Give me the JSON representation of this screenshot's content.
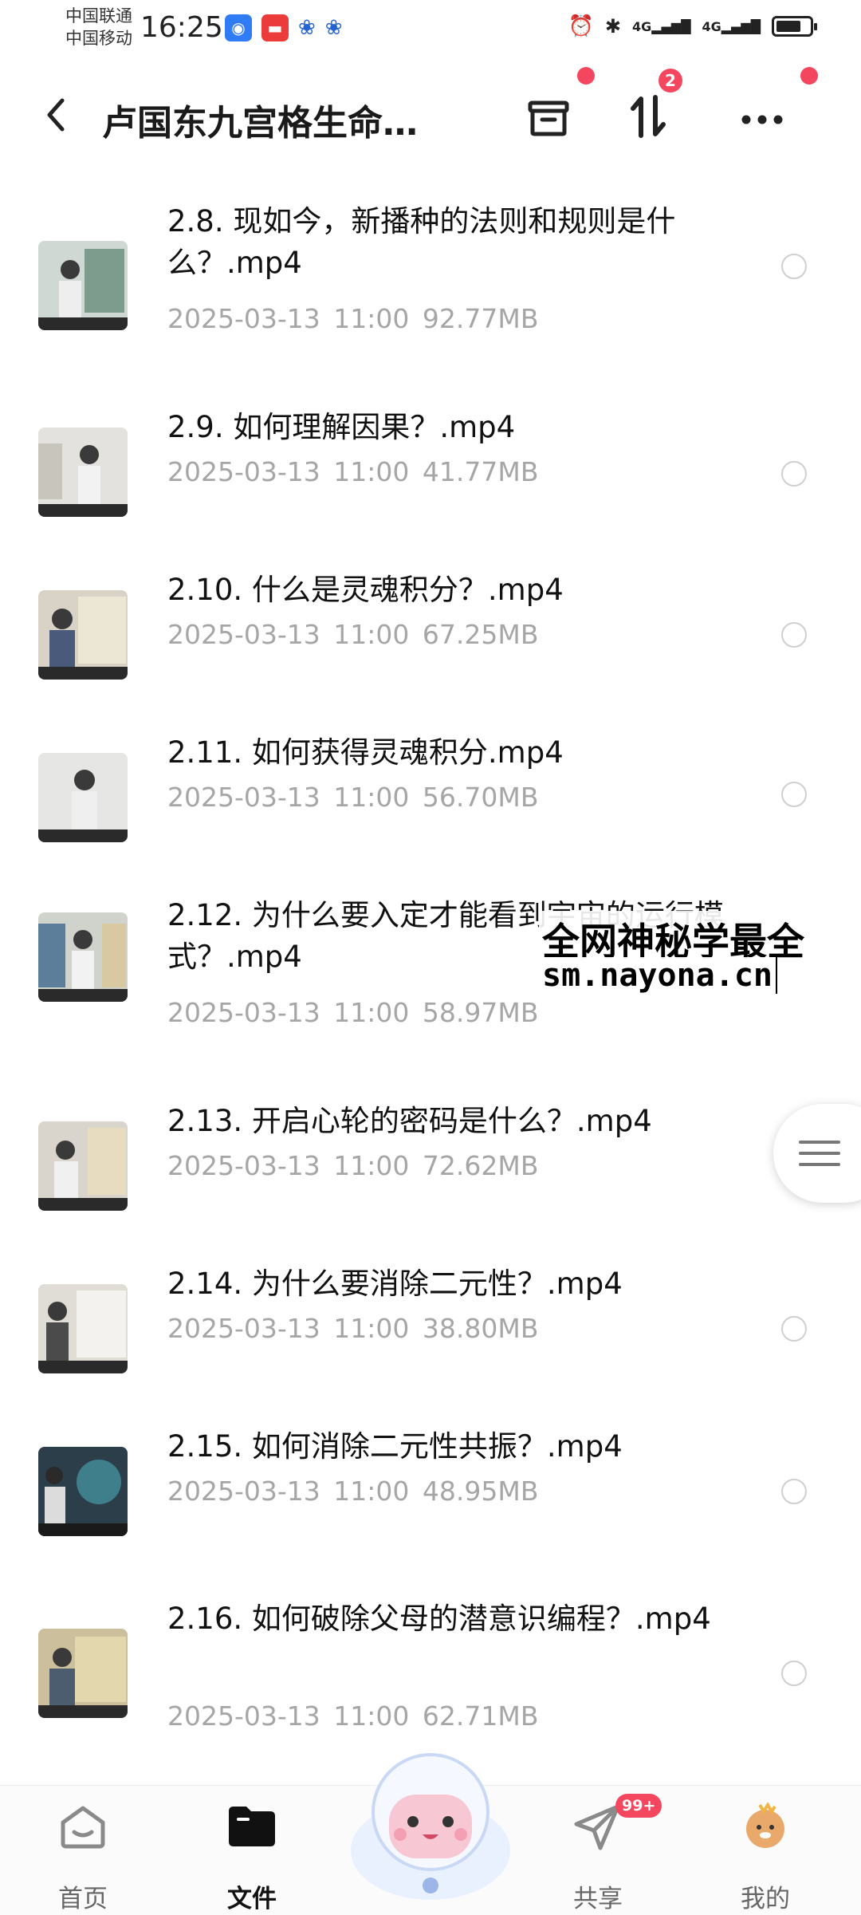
{
  "status_bar": {
    "carrier_1": "中国联通",
    "carrier_2": "中国移动",
    "time": "16:25",
    "signal_1": "4G",
    "signal_2": "4G",
    "battery_level": 0.75
  },
  "header": {
    "title": "卢国东九宫格生命…",
    "transfer_badge": "2"
  },
  "files": [
    {
      "name": "2.8. 现如今，新播种的法则和规则是什么？.mp4",
      "date": "2025-03-13",
      "time": "11:00",
      "size": "92.77MB"
    },
    {
      "name": "2.9. 如何理解因果？.mp4",
      "date": "2025-03-13",
      "time": "11:00",
      "size": "41.77MB"
    },
    {
      "name": "2.10.  什么是灵魂积分？.mp4",
      "date": "2025-03-13",
      "time": "11:00",
      "size": "67.25MB"
    },
    {
      "name": "2.11. 如何获得灵魂积分.mp4",
      "date": "2025-03-13",
      "time": "11:00",
      "size": "56.70MB"
    },
    {
      "name": "2.12. 为什么要入定才能看到宇宙的运行模式？.mp4",
      "date": "2025-03-13",
      "time": "11:00",
      "size": "58.97MB"
    },
    {
      "name": "2.13. 开启心轮的密码是什么？.mp4",
      "date": "2025-03-13",
      "time": "11:00",
      "size": "72.62MB"
    },
    {
      "name": "2.14. 为什么要消除二元性？.mp4",
      "date": "2025-03-13",
      "time": "11:00",
      "size": "38.80MB"
    },
    {
      "name": "2.15. 如何消除二元性共振？.mp4",
      "date": "2025-03-13",
      "time": "11:00",
      "size": "48.95MB"
    },
    {
      "name": "2.16. 如何破除父母的潜意识编程？.mp4",
      "date": "2025-03-13",
      "time": "11:00",
      "size": "62.71MB"
    }
  ],
  "watermark": {
    "line1": "全网神秘学最全",
    "line2": "sm.nayona.cn"
  },
  "bottom_nav": {
    "items": [
      {
        "label": "首页",
        "icon": "home-icon"
      },
      {
        "label": "文件",
        "icon": "folder-icon"
      },
      {
        "label": "共享",
        "icon": "share-send-icon"
      },
      {
        "label": "我的",
        "icon": "avatar-icon"
      }
    ],
    "share_badge": "99+"
  }
}
